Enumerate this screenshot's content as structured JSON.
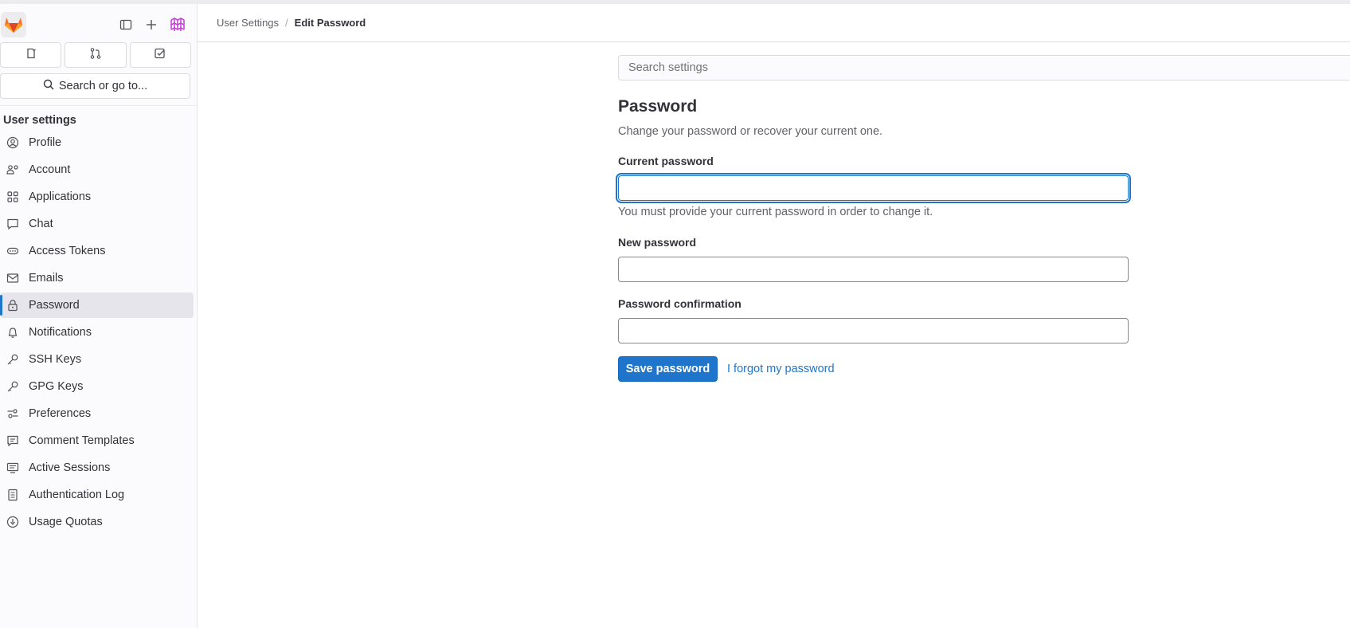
{
  "colors": {
    "accent": "#1f75cb",
    "sidebar_bg": "#fbfafd",
    "text": "#333238"
  },
  "sidebar": {
    "quick_actions": [
      "issues-icon",
      "merge-request-icon",
      "todo-icon"
    ],
    "search_label": "Search or go to...",
    "heading": "User settings",
    "items": [
      {
        "label": "Profile",
        "icon": "profile-icon"
      },
      {
        "label": "Account",
        "icon": "account-icon"
      },
      {
        "label": "Applications",
        "icon": "applications-icon"
      },
      {
        "label": "Chat",
        "icon": "chat-icon"
      },
      {
        "label": "Access Tokens",
        "icon": "token-icon"
      },
      {
        "label": "Emails",
        "icon": "mail-icon"
      },
      {
        "label": "Password",
        "icon": "lock-icon",
        "active": true
      },
      {
        "label": "Notifications",
        "icon": "bell-icon"
      },
      {
        "label": "SSH Keys",
        "icon": "key-icon"
      },
      {
        "label": "GPG Keys",
        "icon": "key-icon"
      },
      {
        "label": "Preferences",
        "icon": "preferences-icon"
      },
      {
        "label": "Comment Templates",
        "icon": "comment-icon"
      },
      {
        "label": "Active Sessions",
        "icon": "monitor-icon"
      },
      {
        "label": "Authentication Log",
        "icon": "log-icon"
      },
      {
        "label": "Usage Quotas",
        "icon": "quota-icon"
      }
    ]
  },
  "breadcrumb": {
    "parent": "User Settings",
    "separator": "/",
    "current": "Edit Password"
  },
  "main": {
    "search_placeholder": "Search settings",
    "title": "Password",
    "description": "Change your password or recover your current one.",
    "current_password": {
      "label": "Current password",
      "value": "",
      "help": "You must provide your current password in order to change it."
    },
    "new_password": {
      "label": "New password",
      "value": ""
    },
    "confirm_password": {
      "label": "Password confirmation",
      "value": ""
    },
    "save_label": "Save password",
    "forgot_label": "I forgot my password"
  }
}
